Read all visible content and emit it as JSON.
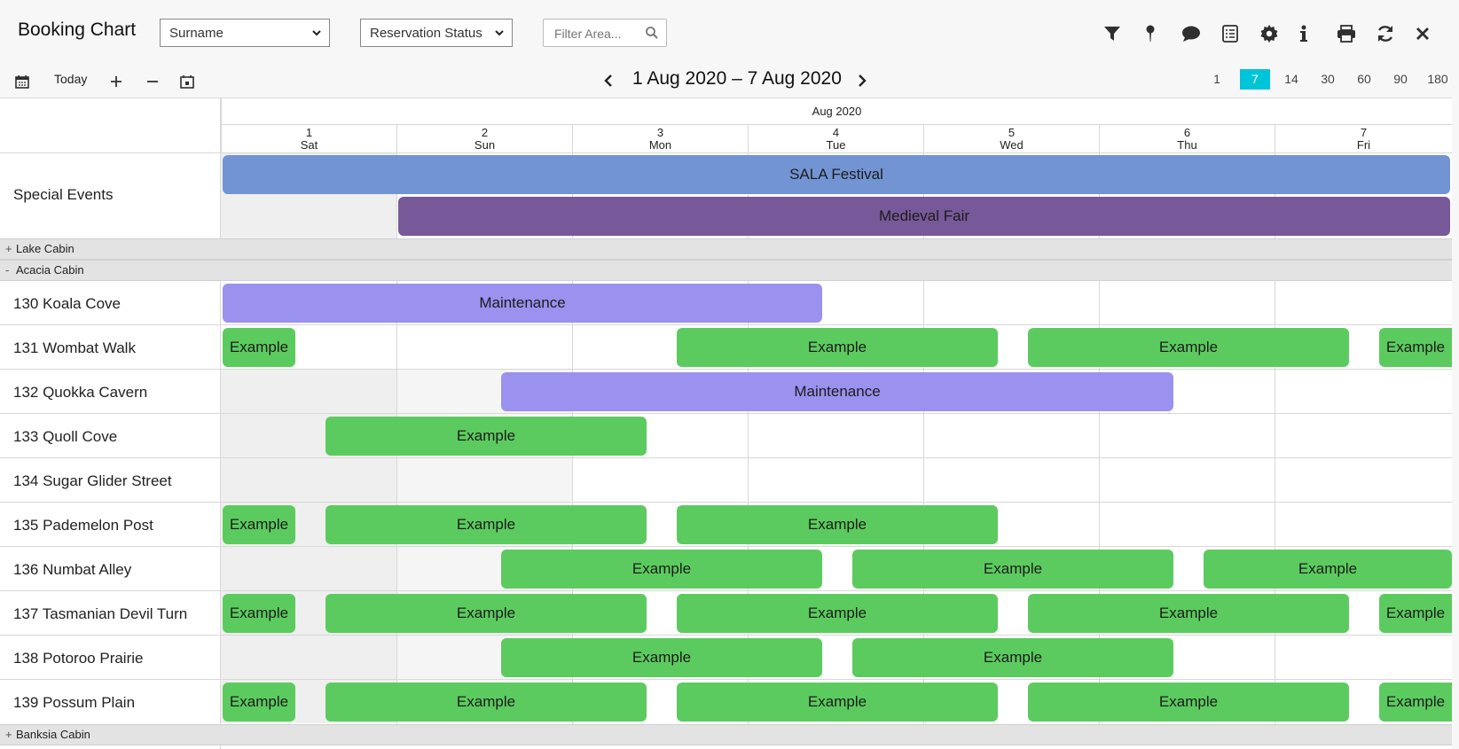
{
  "header": {
    "title": "Booking Chart",
    "sort_select": "Surname",
    "status_select": "Reservation Status",
    "filter_placeholder": "Filter Area..."
  },
  "toolbar_icons": [
    "filter-icon",
    "map-pin-icon",
    "comment-icon",
    "list-icon",
    "gear-icon",
    "info-icon",
    "print-icon",
    "refresh-icon",
    "close-icon"
  ],
  "nav": {
    "today": "Today",
    "range": "1 Aug 2020 – 7 Aug 2020",
    "zoom_options": [
      "1",
      "7",
      "14",
      "30",
      "60",
      "90",
      "180"
    ],
    "active_zoom": "7"
  },
  "calendar": {
    "month": "Aug 2020",
    "days": [
      {
        "num": "1",
        "dow": "Sat"
      },
      {
        "num": "2",
        "dow": "Sun"
      },
      {
        "num": "3",
        "dow": "Mon"
      },
      {
        "num": "4",
        "dow": "Tue"
      },
      {
        "num": "5",
        "dow": "Wed"
      },
      {
        "num": "6",
        "dow": "Thu"
      },
      {
        "num": "7",
        "dow": "Fri"
      }
    ]
  },
  "special_events": {
    "label": "Special Events",
    "events": [
      {
        "name": "SALA Festival"
      },
      {
        "name": "Medieval Fair"
      }
    ]
  },
  "groups": {
    "lake": {
      "label": "Lake Cabin",
      "toggle": "+"
    },
    "acacia": {
      "label": "Acacia Cabin",
      "toggle": "-"
    },
    "banksia": {
      "label": "Banksia Cabin",
      "toggle": "+"
    }
  },
  "booking_label": "Example",
  "maintenance_label": "Maintenance",
  "rooms": [
    {
      "name": "130 Koala Cove"
    },
    {
      "name": "131 Wombat Walk"
    },
    {
      "name": "132 Quokka Cavern"
    },
    {
      "name": "133 Quoll Cove"
    },
    {
      "name": "134 Sugar Glider Street"
    },
    {
      "name": "135 Pademelon Post"
    },
    {
      "name": "136 Numbat Alley"
    },
    {
      "name": "137 Tasmanian Devil Turn"
    },
    {
      "name": "138 Potoroo Prairie"
    },
    {
      "name": "139 Possum Plain"
    }
  ]
}
